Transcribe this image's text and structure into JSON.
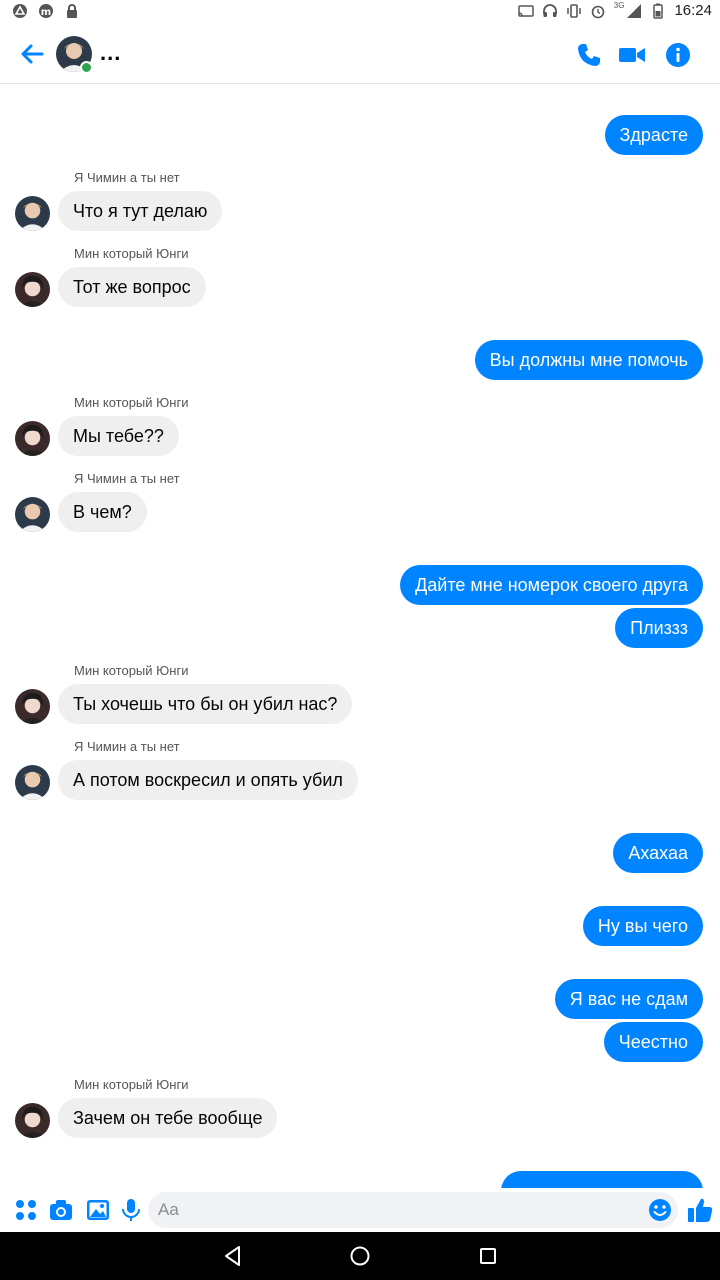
{
  "status_bar": {
    "time": "16:24",
    "network": "3G",
    "icons": [
      "notification-icon",
      "app-m-icon",
      "lock-icon",
      "cast-icon",
      "headphones-icon",
      "vibrate-icon",
      "alarm-icon",
      "signal-icon",
      "battery-icon"
    ]
  },
  "header": {
    "title": "...",
    "icons": [
      "back-arrow-icon",
      "phone-icon",
      "video-camera-icon",
      "info-icon"
    ],
    "accent_color": "#0084ff",
    "online_color": "#31a24c"
  },
  "messages": [
    {
      "dir": "out",
      "text": "Здрасте"
    },
    {
      "dir": "in",
      "sender": "Я Чимин а ты нет",
      "text": "Что я тут делаю"
    },
    {
      "dir": "in",
      "sender": "Мин который Юнги",
      "text": "Тот же вопрос"
    },
    {
      "dir": "out",
      "text": "Вы должны мне помочь"
    },
    {
      "dir": "in",
      "sender": "Мин который Юнги",
      "text": "Мы тебе??"
    },
    {
      "dir": "in",
      "sender": "Я Чимин а ты нет",
      "text": "В чем?"
    },
    {
      "dir": "out",
      "text": "Дайте мне номерок своего друга"
    },
    {
      "dir": "out",
      "text": "Плиззз"
    },
    {
      "dir": "in",
      "sender": "Мин который Юнги",
      "text": "Ты хочешь что бы он убил нас?"
    },
    {
      "dir": "in",
      "sender": "Я Чимин а ты нет",
      "text": "А потом воскресил и опять убил"
    },
    {
      "dir": "out",
      "text": "Ахахаа"
    },
    {
      "dir": "out",
      "text": "Ну вы чего"
    },
    {
      "dir": "out",
      "text": "Я вас не сдам"
    },
    {
      "dir": "out",
      "text": "Чеестно"
    },
    {
      "dir": "in",
      "sender": "Мин который Юнги",
      "text": "Зачем он тебе вообще"
    }
  ],
  "composer": {
    "placeholder": "Aa",
    "icons": [
      "apps-grid-icon",
      "camera-icon",
      "gallery-icon",
      "microphone-icon",
      "emoji-icon",
      "thumbs-up-icon"
    ]
  },
  "colors": {
    "outgoing_bubble": "#0084ff",
    "incoming_bubble": "#efefef"
  },
  "nav_bar": {
    "icons": [
      "nav-back-icon",
      "nav-home-icon",
      "nav-recents-icon"
    ]
  }
}
